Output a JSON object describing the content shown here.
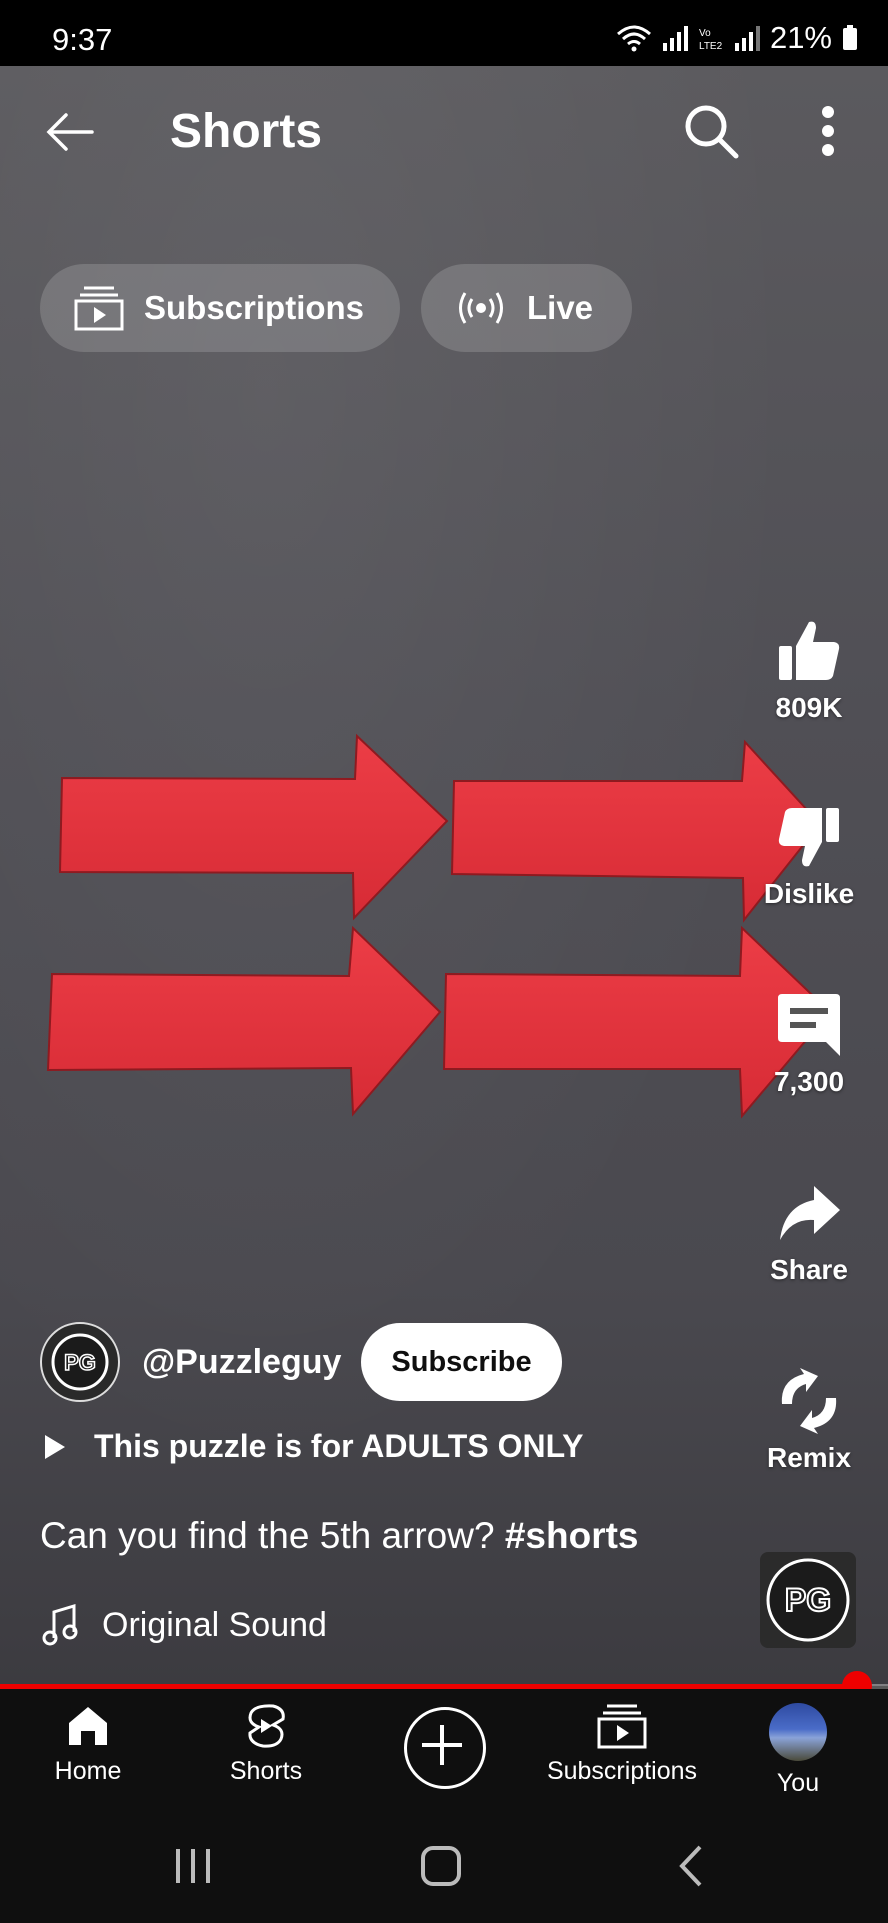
{
  "status_bar": {
    "time": "9:37",
    "battery": "21%"
  },
  "header": {
    "title": "Shorts"
  },
  "chips": [
    {
      "label": "Subscriptions",
      "icon": "subscriptions-icon"
    },
    {
      "label": "Live",
      "icon": "live-icon"
    }
  ],
  "actions": {
    "like_count": "809K",
    "dislike_label": "Dislike",
    "comment_count": "7,300",
    "share_label": "Share",
    "remix_label": "Remix"
  },
  "video": {
    "channel_handle": "@Puzzleguy",
    "channel_avatar_text": "PG",
    "subscribe_label": "Subscribe",
    "playlist_title": "This puzzle is for ADULTS ONLY",
    "caption": "Can you find the 5th arrow?",
    "hashtag": "#shorts",
    "sound": "Original Sound",
    "progress": 0.965
  },
  "bottom_nav": [
    {
      "label": "Home",
      "icon": "home-icon"
    },
    {
      "label": "Shorts",
      "icon": "shorts-icon"
    },
    {
      "label": "",
      "icon": "create-icon"
    },
    {
      "label": "Subscriptions",
      "icon": "subscriptions-icon"
    },
    {
      "label": "You",
      "icon": "avatar"
    }
  ],
  "colors": {
    "accent": "#ff0000",
    "arrow_red": "#e8323c",
    "nav_bg": "#0f0f0f"
  }
}
